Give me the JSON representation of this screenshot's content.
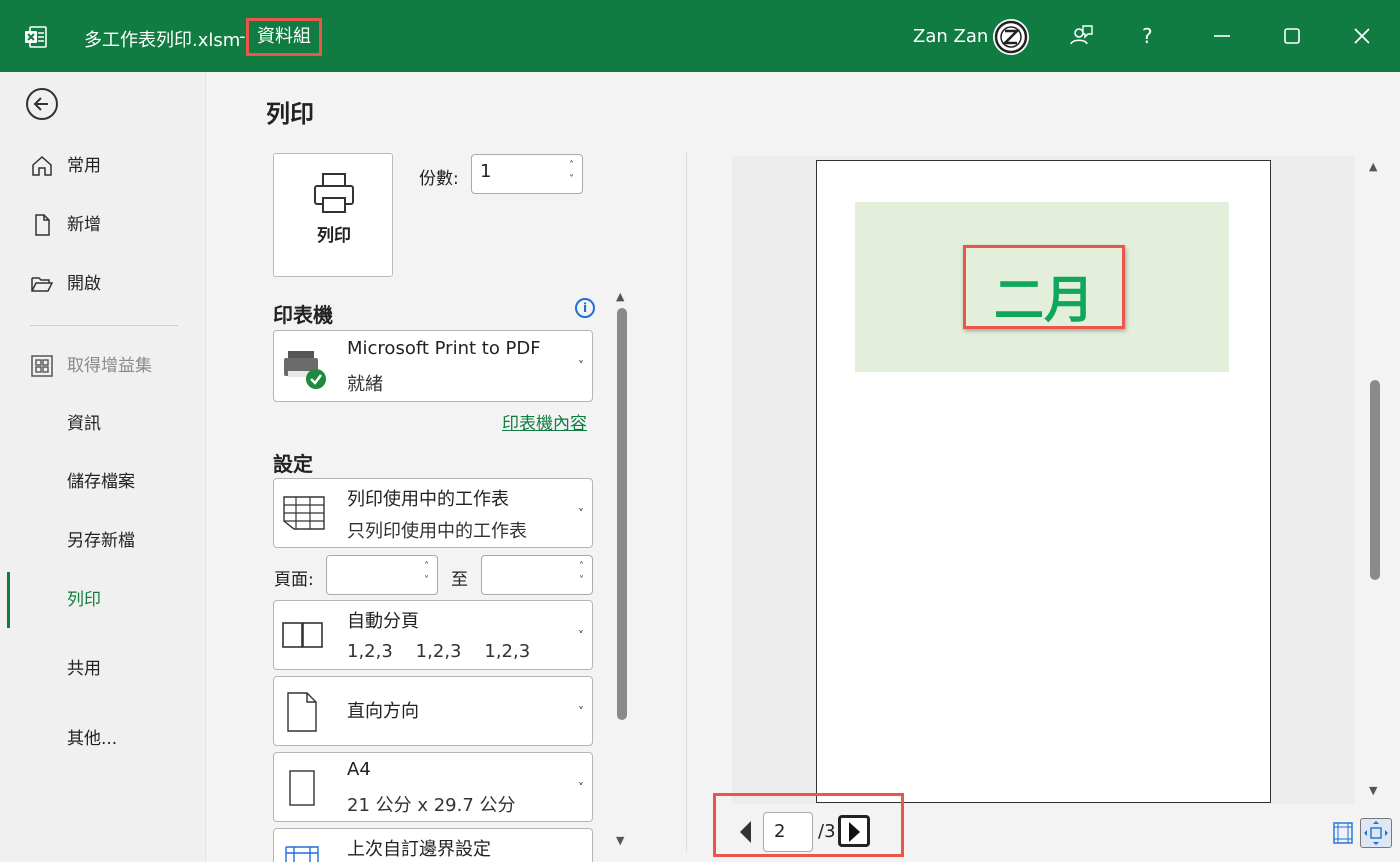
{
  "titlebar": {
    "filename": "多工作表列印.xlsm",
    "separator": "-",
    "group": "資料組",
    "user": "Zan Zan",
    "help": "?"
  },
  "nav": {
    "items": [
      {
        "label": "常用",
        "icon": "home-icon"
      },
      {
        "label": "新增",
        "icon": "new-file-icon"
      },
      {
        "label": "開啟",
        "icon": "folder-open-icon"
      },
      {
        "label": "取得增益集",
        "icon": "add-ins-icon",
        "disabled": true
      },
      {
        "label": "資訊"
      },
      {
        "label": "儲存檔案"
      },
      {
        "label": "另存新檔"
      },
      {
        "label": "列印",
        "active": true
      },
      {
        "label": "共用"
      },
      {
        "label": "其他..."
      }
    ]
  },
  "print": {
    "heading": "列印",
    "button_label": "列印",
    "copies_label": "份數:",
    "copies_value": "1"
  },
  "printer": {
    "section_title": "印表機",
    "name": "Microsoft Print to PDF",
    "status": "就緒",
    "properties_link": "印表機內容"
  },
  "settings": {
    "section_title": "設定",
    "scope_title": "列印使用中的工作表",
    "scope_desc": "只列印使用中的工作表",
    "pages_label": "頁面:",
    "to_label": "至",
    "collate_title": "自動分頁",
    "collate_desc": "1,2,3    1,2,3    1,2,3",
    "orientation": "直向方向",
    "paper_title": "A4",
    "paper_desc": "21 公分 x 29.7 公分",
    "margins_title": "上次自訂邊界設定"
  },
  "preview": {
    "cell_text": "二月",
    "current_page": "2",
    "total_pages": "/3"
  },
  "colors": {
    "brand": "#107c41",
    "highlight": "#e8574a",
    "cell_fill": "#e3efdb",
    "cell_text": "#0fa75a"
  }
}
